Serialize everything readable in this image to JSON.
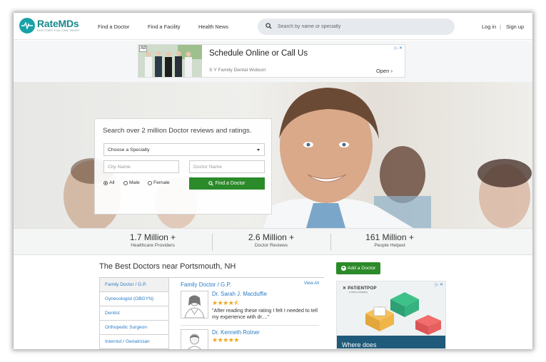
{
  "header": {
    "logo_name": "RateMDs",
    "logo_tagline": "DOCTORS YOU CAN TRUST",
    "nav": [
      "Find a Doctor",
      "Find a Facility",
      "Health News"
    ],
    "search_placeholder": "Search by name or specialty",
    "login": "Log in",
    "separator": "|",
    "signup": "Sign up"
  },
  "top_ad": {
    "badge": "Ad",
    "title": "Schedule Online or Call Us",
    "subtitle": "S Y Family Dental Woburn",
    "cta": "Open",
    "cta_icon": "chevron-right-icon",
    "corner": "▷ ✕"
  },
  "hero": {
    "panel_title": "Search over 2 million Doctor reviews and ratings.",
    "specialty_select": "Choose a Specialty",
    "city_placeholder": "City Name",
    "doctor_placeholder": "Doctor Name",
    "gender_options": [
      "All",
      "Male",
      "Female"
    ],
    "gender_selected": "All",
    "find_button": "Find a Doctor"
  },
  "stats": [
    {
      "number": "1.7 Million +",
      "label": "Healthcare Providers"
    },
    {
      "number": "2.6 Million +",
      "label": "Doctor Reviews"
    },
    {
      "number": "161 Million +",
      "label": "People Helped"
    }
  ],
  "best_doctors": {
    "title": "The Best Doctors near Portsmouth, NH",
    "specialties": [
      "Family Doctor / G.P.",
      "Gynecologist (OBGYN)",
      "Dentist",
      "Orthopedic Surgeon",
      "Internist / Geriatrician"
    ],
    "category_title": "Family Doctor / G.P.",
    "view_all": "View All",
    "doctors": [
      {
        "name": "Dr. Sarah J. Macduffie",
        "rating": 4.5,
        "stars": "★★★★⯪",
        "quote": "\"After reading these rating I felt I needed to tell my experience with dr....\""
      },
      {
        "name": "Dr. Kenneth Rotner",
        "rating": 5,
        "stars": "★★★★★",
        "quote": ""
      }
    ]
  },
  "sidebar": {
    "add_doctor": "Add a Doctor",
    "ad_logo": "PATIENTPOP",
    "ad_logo_sub": "a tebra company",
    "ad_corner": "▷ ✕",
    "ad_text": "Where does"
  },
  "colors": {
    "brand_teal": "#17a2a7",
    "green_button": "#2b8a29",
    "link_blue": "#2a7cc7",
    "star": "#f0a51d"
  }
}
